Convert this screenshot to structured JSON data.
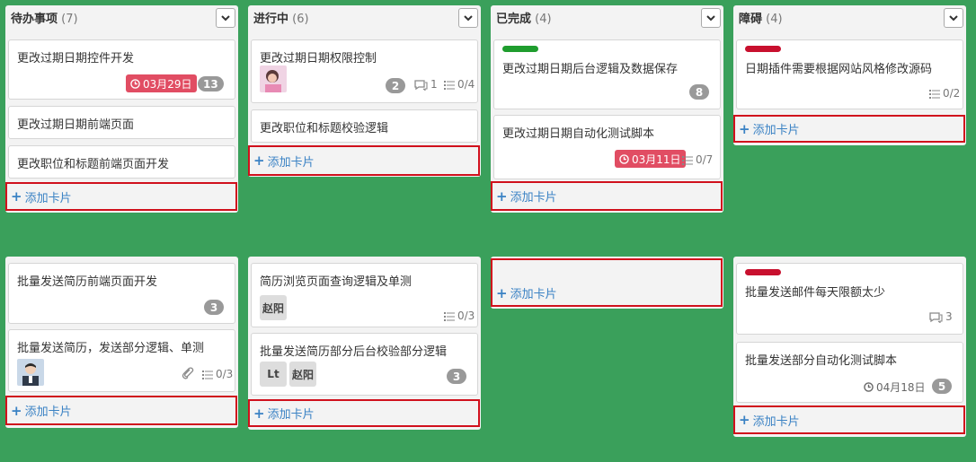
{
  "colors": {
    "background": "#3aa05b",
    "due_red": "#e14d63",
    "label_green": "#1f9d2e",
    "label_red": "#c8102e",
    "add_border": "#d0101c",
    "link_blue": "#3a82c4"
  },
  "add_card_label": "添加卡片",
  "columns": [
    {
      "title": "待办事项",
      "count": "(7)"
    },
    {
      "title": "进行中",
      "count": "(6)"
    },
    {
      "title": "已完成",
      "count": "(4)"
    },
    {
      "title": "障碍",
      "count": "(4)"
    }
  ],
  "cards": {
    "c1": {
      "title": "更改过期日期控件开发",
      "due": "03月29日",
      "count": "13"
    },
    "c2": {
      "title": "更改过期日期前端页面"
    },
    "c3": {
      "title": "更改职位和标题前端页面开发"
    },
    "c4": {
      "title": "更改过期日期权限控制",
      "count": "2",
      "comments": "1",
      "checklist": "0/4"
    },
    "c5": {
      "title": "更改职位和标题校验逻辑"
    },
    "c6": {
      "title": "更改过期日期后台逻辑及数据保存",
      "count": "8"
    },
    "c7": {
      "title": "更改过期日期自动化测试脚本",
      "due": "03月11日",
      "checklist": "0/7"
    },
    "c8": {
      "title": "日期插件需要根据网站风格修改源码",
      "checklist": "0/2"
    },
    "c9": {
      "title": "批量发送简历前端页面开发",
      "count": "3"
    },
    "c10": {
      "title": "批量发送简历，发送部分逻辑、单测",
      "checklist": "0/3"
    },
    "c11": {
      "title": "简历浏览页面查询逻辑及单测",
      "member": "赵阳",
      "checklist": "0/3"
    },
    "c12": {
      "title": "批量发送简历部分后台校验部分逻辑",
      "member1": "Lt",
      "member2": "赵阳",
      "count": "3"
    },
    "c13": {
      "title": "批量发送邮件每天限额太少",
      "comments": "3"
    },
    "c14": {
      "title": "批量发送部分自动化测试脚本",
      "due": "04月18日",
      "count": "5"
    }
  }
}
